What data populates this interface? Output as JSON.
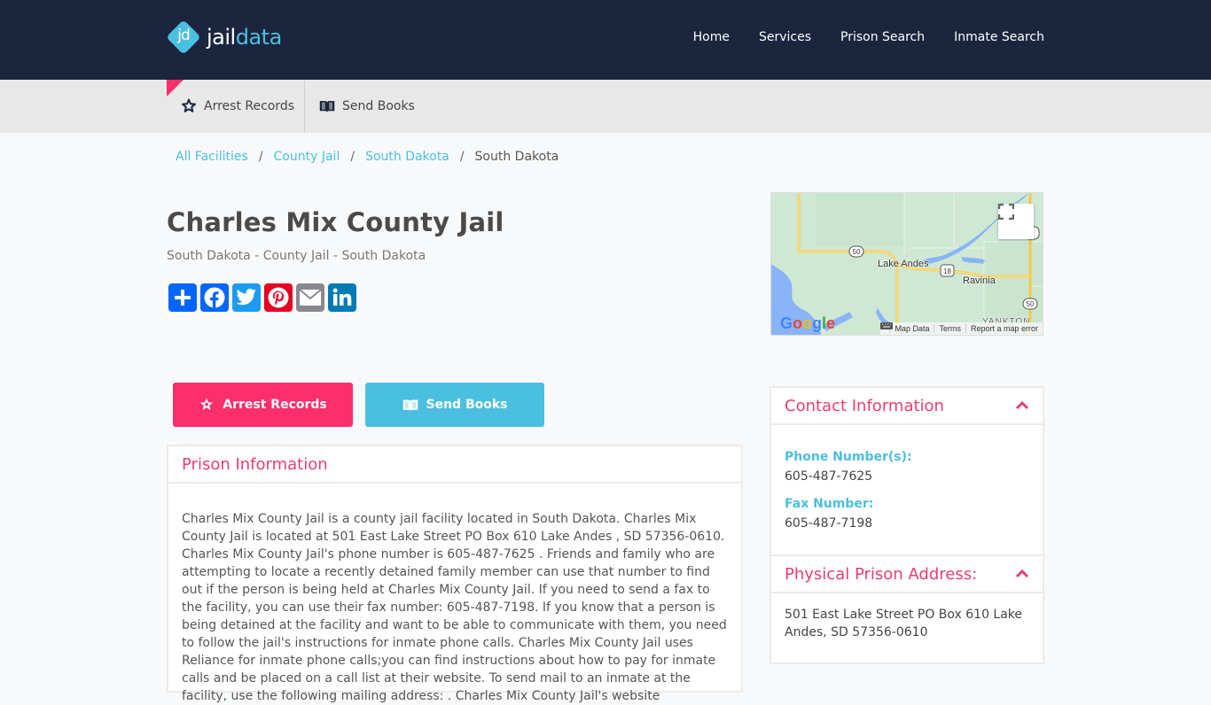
{
  "brand": {
    "badge": "jd",
    "name_part1": "jail",
    "name_part2": "data",
    "colors": {
      "navy": "#1b253e",
      "accent_pink": "#fc2e6c",
      "accent_blue": "#4bbfdf"
    }
  },
  "nav": {
    "items": [
      {
        "label": "Home"
      },
      {
        "label": "Services"
      },
      {
        "label": "Prison Search"
      },
      {
        "label": "Inmate Search"
      }
    ]
  },
  "subbar": {
    "arrest_label": "Arrest Records",
    "books_label": "Send Books"
  },
  "breadcrumb": {
    "items": [
      {
        "label": "All Facilities"
      },
      {
        "label": "County Jail"
      },
      {
        "label": "South Dakota"
      }
    ],
    "current": "South Dakota",
    "separator": "/"
  },
  "page": {
    "title": "Charles Mix County Jail",
    "subtitle": "South Dakota - County Jail - South Dakota"
  },
  "share": {
    "items": [
      {
        "name": "share",
        "icon": "plus-icon",
        "color": "#0166ff"
      },
      {
        "name": "facebook",
        "icon": "facebook-icon",
        "color": "#0866ff"
      },
      {
        "name": "twitter",
        "icon": "twitter-icon",
        "color": "#1d9bf0"
      },
      {
        "name": "pinterest",
        "icon": "pinterest-icon",
        "color": "#e60023"
      },
      {
        "name": "email",
        "icon": "email-icon",
        "color": "#888990"
      },
      {
        "name": "linkedin",
        "icon": "linkedin-icon",
        "color": "#007bb5"
      }
    ]
  },
  "map": {
    "labels": {
      "town1": "Lake Andes",
      "town2": "Ravinia",
      "region": "YANKTON"
    },
    "route_shields": [
      "50",
      "18",
      "50"
    ],
    "google": "Google",
    "attribution": [
      "Map Data",
      "Terms",
      "Report a map error"
    ]
  },
  "actions": {
    "arrest_label": "Arrest Records",
    "books_label": "Send Books"
  },
  "prison_info": {
    "heading": "Prison Information",
    "body": "Charles Mix County Jail is a county jail facility located in South Dakota. Charles Mix County Jail is located at 501 East Lake Street PO Box 610 Lake Andes , SD 57356-0610. Charles Mix County Jail's phone number is 605-487-7625 . Friends and family who are attempting to locate a recently detained family member can use that number to find out if the person is being held at Charles Mix County Jail. If you need to send a fax to the facility, you can use their fax number: 605-487-7198. If you know that a person is being detained at the facility and want to be able to communicate with them, you need to follow the jail's instructions for inmate phone calls. Charles Mix County Jail uses Reliance for inmate phone calls;you can find instructions about how to pay for inmate calls and be placed on a call list at their website. To send mail to an inmate at the facility, use the following mailing address: . Charles Mix County Jail's website"
  },
  "contact": {
    "heading": "Contact Information",
    "phone_label": "Phone Number(s):",
    "phone": "605-487-7625",
    "fax_label": "Fax Number:",
    "fax": "605-487-7198"
  },
  "address": {
    "heading": "Physical Prison Address:",
    "value": "501 East Lake Street PO Box 610 Lake Andes, SD 57356-0610"
  }
}
